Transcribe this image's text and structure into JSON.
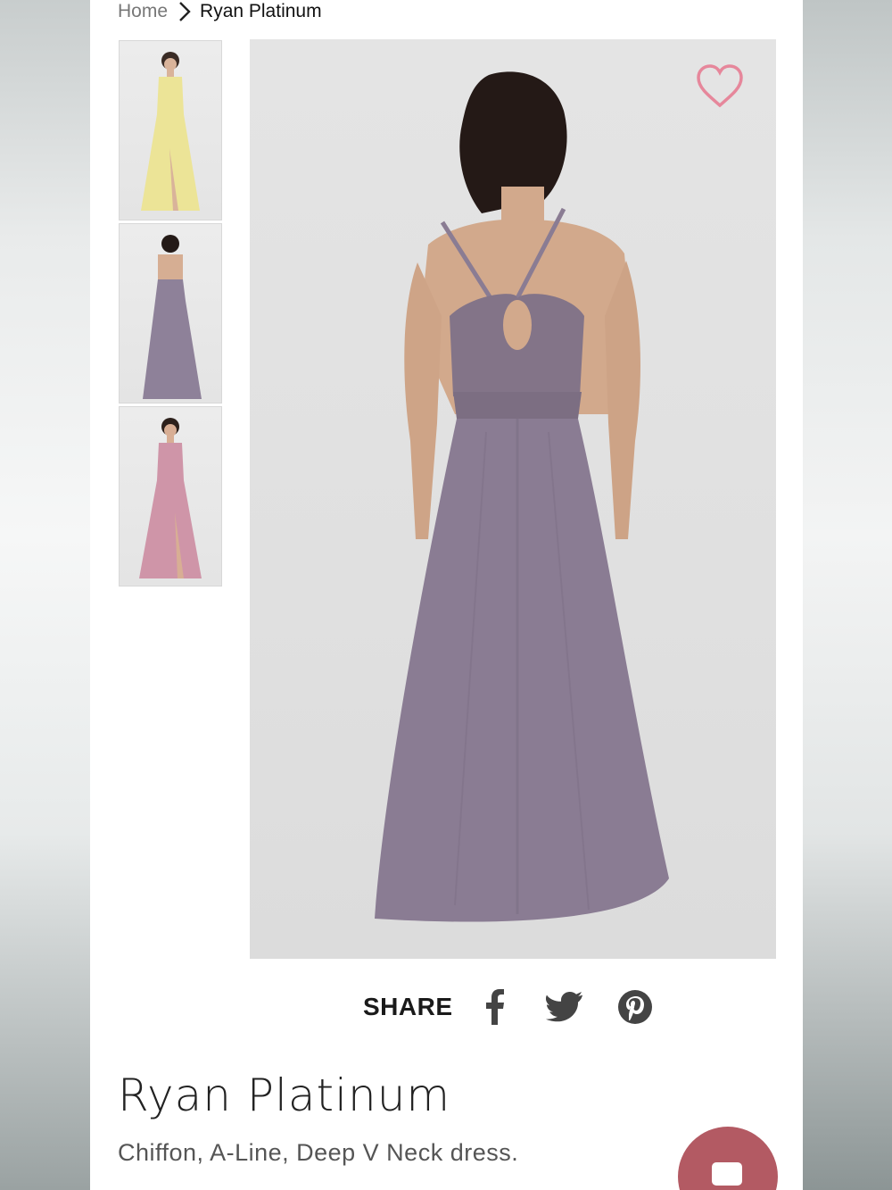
{
  "breadcrumb": {
    "home": "Home",
    "current": "Ryan Platinum"
  },
  "gallery": {
    "thumbnails": [
      {
        "alt": "yellow-dress-front",
        "color": "#ece497"
      },
      {
        "alt": "platinum-dress-back",
        "color": "#8e8199"
      },
      {
        "alt": "pink-dress-front",
        "color": "#cf95a8"
      }
    ],
    "main_color": "#8a7c93",
    "favorite_icon": "heart-outline-icon",
    "favorite_color": "#e6879b"
  },
  "share": {
    "label": "SHARE",
    "networks": [
      "facebook-icon",
      "twitter-icon",
      "pinterest-icon"
    ]
  },
  "product": {
    "title": "Ryan Platinum",
    "description": "Chiffon, A-Line, Deep V Neck dress."
  },
  "chat": {
    "icon": "chat-bubble-icon",
    "color": "#b35a63"
  }
}
